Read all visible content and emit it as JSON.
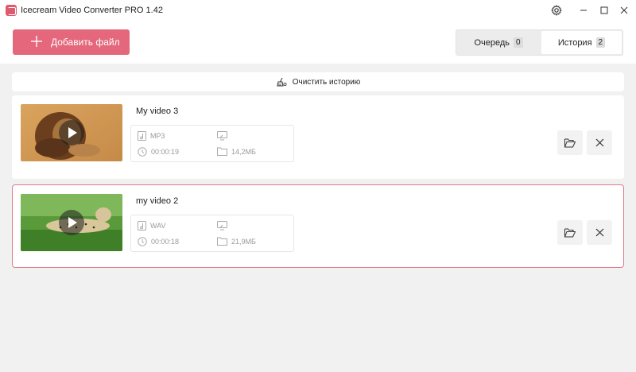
{
  "window": {
    "title": "Icecream Video Converter PRO 1.42",
    "controls": [
      "settings-icon",
      "minimize-icon",
      "maximize-icon",
      "close-icon"
    ]
  },
  "toolbar": {
    "add_file_label": "Добавить файл",
    "accent_color": "#e4677b"
  },
  "tabs": {
    "queue": {
      "label": "Очередь",
      "count": "0"
    },
    "history": {
      "label": "История",
      "count": "2",
      "active": true
    }
  },
  "clear_history": {
    "label": "Очистить историю",
    "icon": "broom-icon"
  },
  "items": [
    {
      "title": "My video 3",
      "format": "MP3",
      "resolution": "",
      "duration": "00:00:19",
      "size": "14,2МБ",
      "thumbnail": "lion-thumbnail",
      "selected": false
    },
    {
      "title": "my video 2",
      "format": "WAV",
      "resolution": "",
      "duration": "00:00:18",
      "size": "21,9МБ",
      "thumbnail": "cheetah-thumbnail",
      "selected": true
    }
  ]
}
